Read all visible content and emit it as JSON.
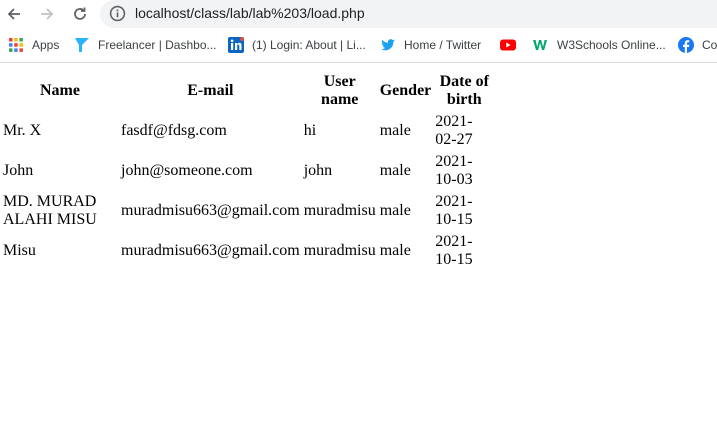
{
  "browser": {
    "url": "localhost/class/lab/lab%203/load.php",
    "bookmarks": [
      {
        "label": "Apps",
        "icon": "apps-grid-icon"
      },
      {
        "label": "Freelancer | Dashbo...",
        "icon": "freelancer-icon"
      },
      {
        "label": "(1) Login: About | Li...",
        "icon": "linkedin-icon"
      },
      {
        "label": "Home / Twitter",
        "icon": "twitter-icon"
      },
      {
        "label": "",
        "icon": "youtube-icon"
      },
      {
        "label": "W3Schools Online...",
        "icon": "w3schools-icon"
      },
      {
        "label": "Co",
        "icon": "facebook-icon"
      }
    ]
  },
  "table": {
    "headers": [
      "Name",
      "E-mail",
      "User name",
      "Gender",
      "Date of birth"
    ],
    "rows": [
      [
        "Mr. X",
        "fasdf@fdsg.com",
        "hi",
        "male",
        "2021-02-27"
      ],
      [
        "John",
        "john@someone.com",
        "john",
        "male",
        "2021-10-03"
      ],
      [
        "MD. MURAD ALAHI MISU",
        "muradmisu663@gmail.com",
        "muradmisu",
        "male",
        "2021-10-15"
      ],
      [
        "Misu",
        "muradmisu663@gmail.com",
        "muradmisu",
        "male",
        "2021-10-15"
      ]
    ]
  }
}
